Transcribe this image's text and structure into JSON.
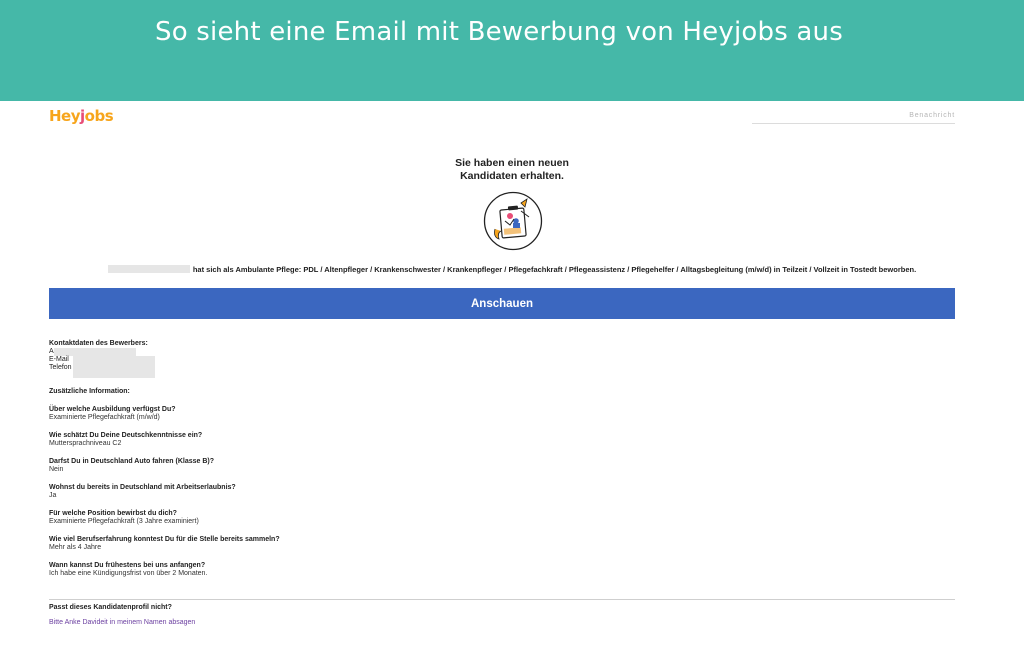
{
  "banner": {
    "title": "So sieht eine Email mit Bewerbung von Heyjobs aus"
  },
  "email": {
    "logo": {
      "part1": "Hey",
      "part2": "j",
      "part3": "obs"
    },
    "notification_label": "Benachricht",
    "headline_line1": "Sie haben einen neuen",
    "headline_line2": "Kandidaten erhalten.",
    "applied_text": "hat sich als Ambulante Pflege: PDL / Altenpfleger / Krankenschwester / Krankenpfleger / Pflegefachkraft / Pflegeassistenz / Pflegehelfer / Alltagsbegleitung (m/w/d) in Teilzeit / Vollzeit in Tostedt beworben.",
    "cta_label": "Anschauen",
    "contact": {
      "title": "Kontaktdaten des Bewerbers:",
      "name_prefix": "A",
      "email_label": "E-Mail",
      "phone_label": "Telefon"
    },
    "extra_title": "Zusätzliche Information:",
    "questions": [
      {
        "q": "Über welche Ausbildung verfügst Du?",
        "a": "Examinierte Pflegefachkraft (m/w/d)"
      },
      {
        "q": "Wie schätzt Du Deine Deutschkenntnisse ein?",
        "a": "Muttersprachniveau C2"
      },
      {
        "q": "Darfst Du in Deutschland Auto fahren (Klasse B)?",
        "a": "Nein"
      },
      {
        "q": "Wohnst du bereits in Deutschland mit Arbeitserlaubnis?",
        "a": "Ja"
      },
      {
        "q": "Für welche Position bewirbst du dich?",
        "a": "Examinierte Pflegefachkraft (3 Jahre examiniert)"
      },
      {
        "q": "Wie viel Berufserfahrung konntest Du für die Stelle bereits sammeln?",
        "a": "Mehr als 4 Jahre"
      },
      {
        "q": "Wann kannst Du frühestens bei uns anfangen?",
        "a": "Ich habe eine Kündigungsfrist von über 2 Monaten."
      }
    ],
    "footer_question": "Passt dieses Kandidatenprofil nicht?",
    "footer_link": "Bitte Anke Davideit in meinem Namen absagen"
  },
  "colors": {
    "banner": "#45b8a8",
    "button": "#3b67c0",
    "link": "#6b3fa0",
    "logo_orange": "#f7a51c",
    "logo_pink": "#e84d77"
  },
  "icons": {
    "illustration": "candidate-clipboard-illustration"
  }
}
